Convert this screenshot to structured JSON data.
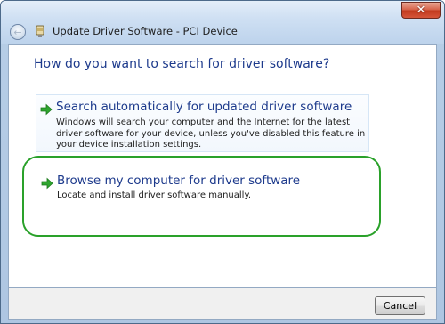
{
  "window": {
    "title": "Update Driver Software - PCI Device",
    "close_glyph": "✕"
  },
  "nav": {
    "back_glyph": "←"
  },
  "main": {
    "heading": "How do you want to search for driver software?",
    "options": [
      {
        "title": "Search automatically for updated driver software",
        "description": "Windows will search your computer and the Internet for the latest driver software for your device, unless you've disabled this feature in your device installation settings.",
        "icon": "green-arrow-icon"
      },
      {
        "title": "Browse my computer for driver software",
        "description": "Locate and install driver software manually.",
        "icon": "green-arrow-icon"
      }
    ]
  },
  "footer": {
    "cancel_label": "Cancel"
  },
  "colors": {
    "heading_blue": "#1d3a8c",
    "highlight_green": "#2aa12a",
    "close_red": "#c23a1e"
  }
}
